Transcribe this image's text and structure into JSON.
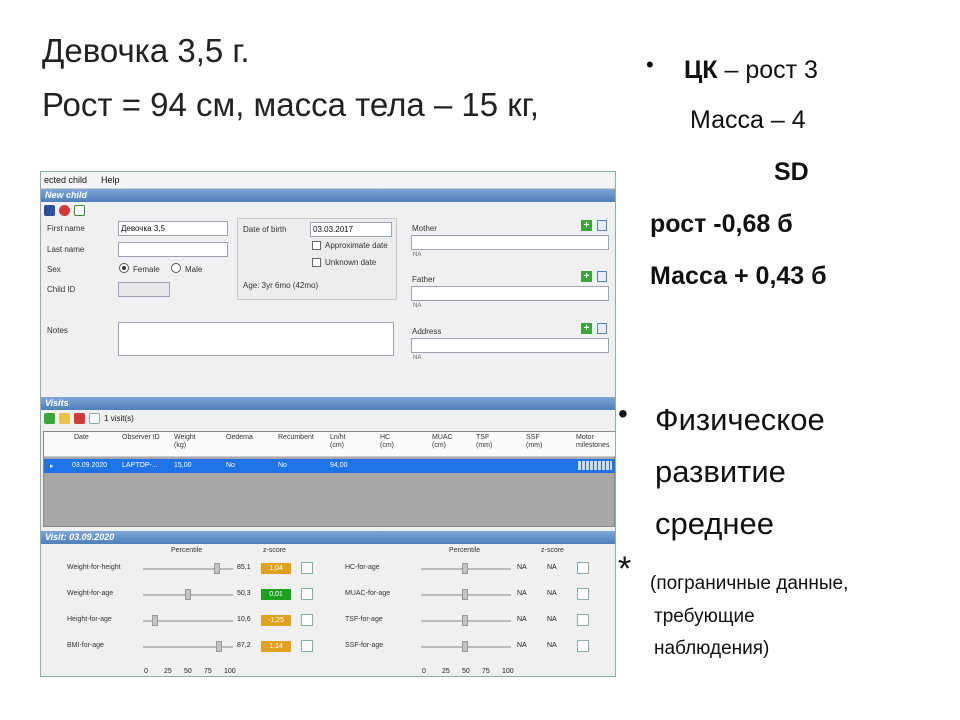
{
  "slide": {
    "title_line1": "Девочка 3,5 г.",
    "title_line2": "Рост = 94 см, масса тела – 15 кг,",
    "ck_bold": "ЦК",
    "ck_rest": " – рост 3",
    "mass": "Масса – 4",
    "sd": "SD",
    "rost_sd": "рост -0,68 б",
    "mass_sd": "Масса + 0,43 б",
    "phys1": "Физическое",
    "phys2": "развитие",
    "phys3": "среднее",
    "star": "*",
    "note1": "(пограничные данные,",
    "note2": "требующие",
    "note3": "наблюдения)"
  },
  "app": {
    "menu": [
      "ected child",
      "Help"
    ],
    "new_child_header": "New child",
    "first_name_label": "First name",
    "first_name_value": "Девочка 3,5",
    "last_name_label": "Last name",
    "sex_label": "Sex",
    "female": "Female",
    "male": "Male",
    "child_id_label": "Child ID",
    "notes_label": "Notes",
    "dob_label": "Date of birth",
    "dob_value": "03.03.2017",
    "approx_date": "Approximate date",
    "unknown_date": "Unknown date",
    "age_text": "Age: 3yr 6mo (42mo)",
    "mother_label": "Mother",
    "father_label": "Father",
    "address_label": "Address",
    "na": "NA",
    "visits_header": "Visits",
    "visit_count": "1 visit(s)",
    "columns": [
      "Date",
      "Observer ID",
      "Weight (kg)",
      "Oedema",
      "Recumbent",
      "Ln/ht (cm)",
      "HC (cm)",
      "MUAC (cm)",
      "TSF (mm)",
      "SSF (mm)",
      "Motor milestones"
    ],
    "row": [
      "03.09.2020",
      "LAPTOP-...",
      "15,00",
      "No",
      "No",
      "94,00"
    ],
    "visit_header": "Visit: 03.09.2020",
    "percentile": "Percentile",
    "zscore": "z-score",
    "left_indicators": [
      {
        "name": "Weight-for-height",
        "pct": "85,1",
        "z": "1,04",
        "color": "#e0a020",
        "pos": 85.1
      },
      {
        "name": "Weight-for-age",
        "pct": "50,3",
        "z": "0,01",
        "color": "#1ea01e",
        "pos": 50.3
      },
      {
        "name": "Height-for-age",
        "pct": "10,6",
        "z": "-1,25",
        "color": "#e0a020",
        "pos": 10.6
      },
      {
        "name": "BMI-for-age",
        "pct": "87,2",
        "z": "1,14",
        "color": "#e0a020",
        "pos": 87.2
      }
    ],
    "right_indicators": [
      {
        "name": "HC-for-age",
        "pct": "NA",
        "z": "NA"
      },
      {
        "name": "MUAC-for-age",
        "pct": "NA",
        "z": "NA"
      },
      {
        "name": "TSF-for-age",
        "pct": "NA",
        "z": "NA"
      },
      {
        "name": "SSF-for-age",
        "pct": "NA",
        "z": "NA"
      }
    ],
    "scale_ticks": [
      "0",
      "25",
      "50",
      "75",
      "100"
    ]
  }
}
